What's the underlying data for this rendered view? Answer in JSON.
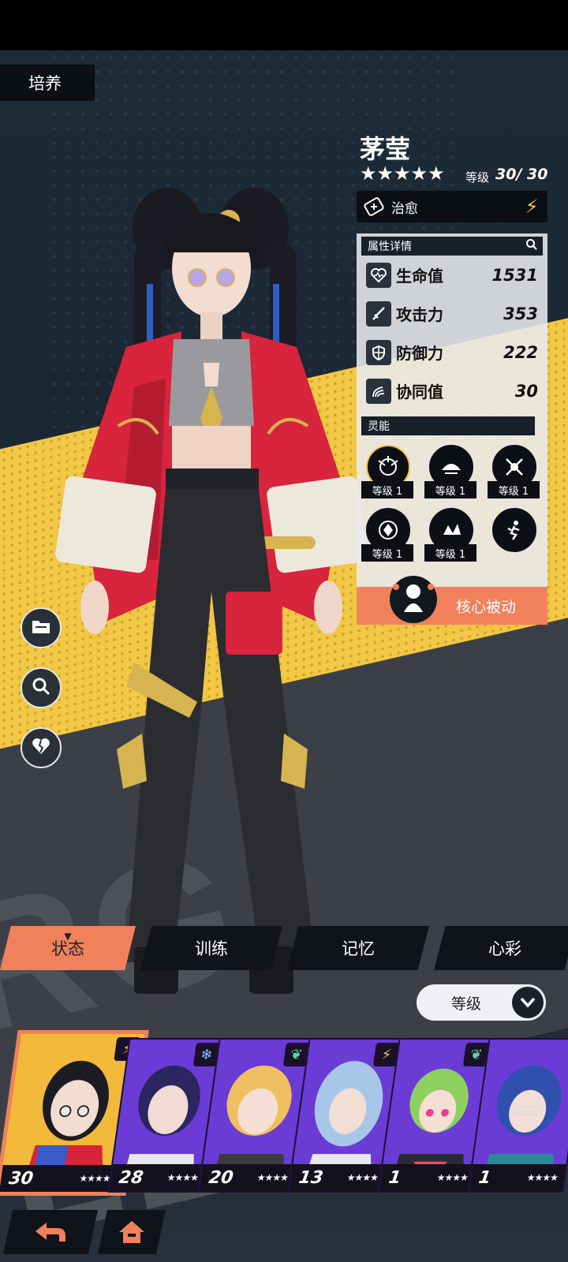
{
  "header": {
    "tab_label": "培养"
  },
  "character": {
    "name": "茅莹",
    "stars": "★★★★★",
    "level_label": "等级",
    "level_value": "30/ 30",
    "role_label": "治愈"
  },
  "stats_panel": {
    "title": "属性详情",
    "stats": [
      {
        "icon": "heartbeat-icon",
        "label": "生命值",
        "value": "1531"
      },
      {
        "icon": "sword-icon",
        "label": "攻击力",
        "value": "353"
      },
      {
        "icon": "shield-icon",
        "label": "防御力",
        "value": "222"
      },
      {
        "icon": "synergy-icon",
        "label": "协同值",
        "value": "30"
      }
    ],
    "psy_title": "灵能",
    "skills": [
      {
        "level": "等级 1"
      },
      {
        "level": "等级 1"
      },
      {
        "level": "等级 1"
      },
      {
        "level": "等级 1"
      },
      {
        "level": "等级 1"
      }
    ],
    "core_label": "核心被动"
  },
  "background_word": "RG LES",
  "tabs": [
    {
      "label": "状态"
    },
    {
      "label": "训练"
    },
    {
      "label": "记忆"
    },
    {
      "label": "心彩"
    }
  ],
  "sort": {
    "label": "等级"
  },
  "roster": [
    {
      "level": "30",
      "stars": "★★★★★",
      "attr": "lightning-icon"
    },
    {
      "level": "28",
      "stars": "★★★★",
      "attr": "snowflake-icon"
    },
    {
      "level": "20",
      "stars": "★★★★",
      "attr": "wind-icon"
    },
    {
      "level": "13",
      "stars": "★★★★",
      "attr": "lightning-icon"
    },
    {
      "level": "1",
      "stars": "★★★★",
      "attr": "wind-icon"
    },
    {
      "level": "1",
      "stars": "★★★★",
      "attr": "none"
    }
  ],
  "colors": {
    "accent": "#f0815a",
    "yellow": "#f2c744",
    "panel": "#e8eaee",
    "dark": "#10141a"
  }
}
